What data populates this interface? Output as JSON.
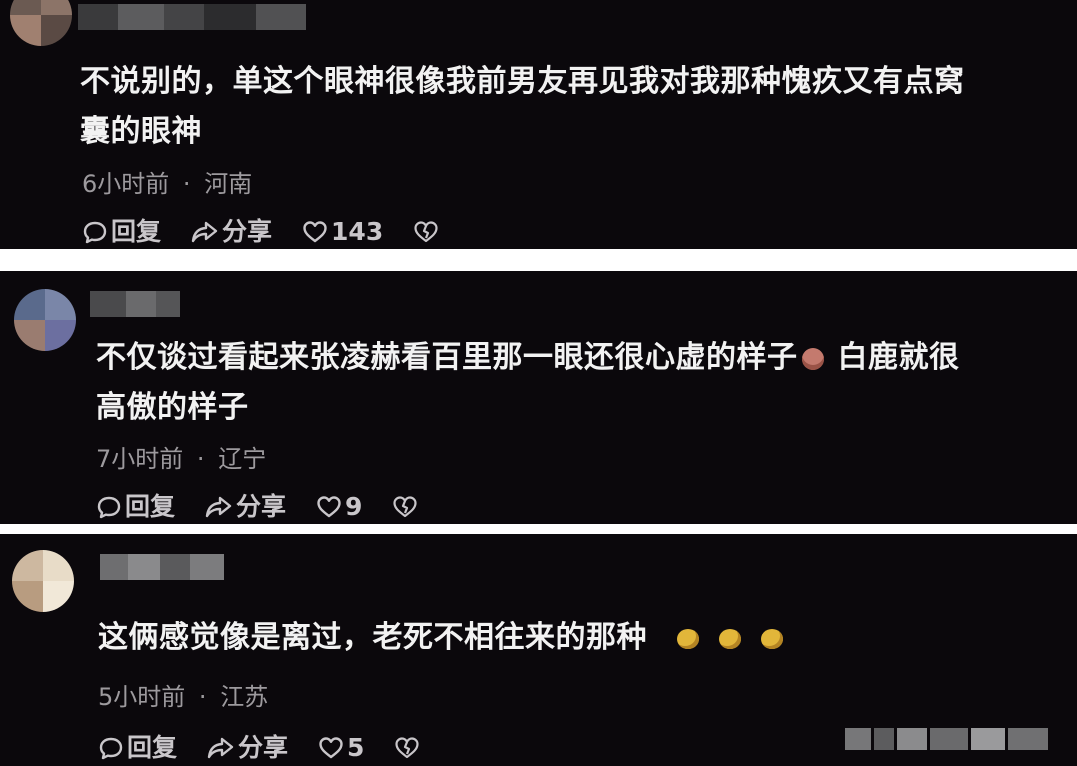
{
  "comments": [
    {
      "text_line1": "不说别的，单这个眼神很像我前男友再见我对我那种愧疚又有点窝",
      "text_line2": "囊的眼神",
      "time": "6小时前",
      "location": "河南",
      "reply_label": "回复",
      "share_label": "分享",
      "like_count": "143"
    },
    {
      "text_line1a": "不仅谈过看起来张凌赫看百里那一眼还很心虚的样子",
      "text_line1b": "白鹿就很",
      "text_line2": "高傲的样子",
      "time": "7小时前",
      "location": "辽宁",
      "reply_label": "回复",
      "share_label": "分享",
      "like_count": "9"
    },
    {
      "text_line1": "这俩感觉像是离过，老死不相往来的那种",
      "time": "5小时前",
      "location": "江苏",
      "reply_label": "回复",
      "share_label": "分享",
      "like_count": "5"
    }
  ],
  "meta_separator": "·",
  "icons": [
    "comment-icon",
    "share-icon",
    "heart-icon",
    "dislike-heart-icon",
    "pig-emoji",
    "lemon-emoji"
  ],
  "colors": {
    "panel_bg": "#0b080c",
    "text": "#f2f2f2",
    "meta": "#9d9a9e",
    "divider": "#ffffff"
  }
}
